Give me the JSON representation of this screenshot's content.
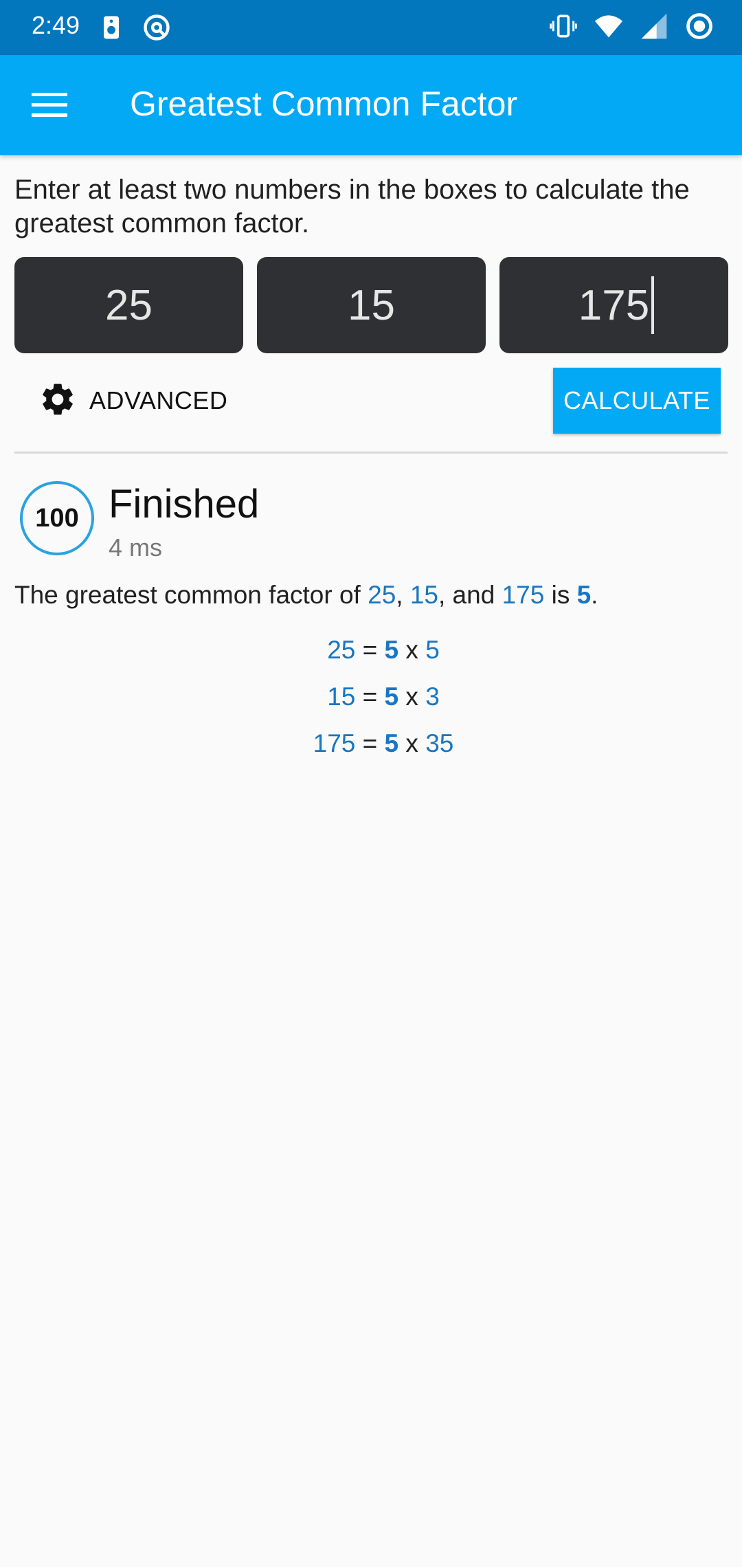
{
  "status_bar": {
    "time": "2:49",
    "left_icons": [
      "speaker-icon",
      "at-sign-icon"
    ],
    "right_icons": [
      "vibrate-icon",
      "wifi-icon",
      "signal-icon",
      "record-icon"
    ]
  },
  "app_bar": {
    "menu_icon": "hamburger-menu-icon",
    "title": "Greatest Common Factor"
  },
  "instructions": "Enter at least two numbers in the boxes to calculate the greatest common factor.",
  "inputs": [
    "25",
    "15",
    "175"
  ],
  "advanced_button": {
    "icon": "gear-icon",
    "label": "ADVANCED"
  },
  "calculate_button": {
    "label": "CALCULATE"
  },
  "result": {
    "progress": "100",
    "status": "Finished",
    "elapsed": "4 ms",
    "sentence": {
      "prefix": "The greatest common factor of ",
      "numbers": [
        "25",
        "15",
        "175"
      ],
      "sep1": ", ",
      "sep2": ", and ",
      "is_text": " is ",
      "gcf": "5",
      "end": "."
    },
    "factorizations": [
      {
        "number": "25",
        "gcf": "5",
        "cofactor": "5"
      },
      {
        "number": "15",
        "gcf": "5",
        "cofactor": "3"
      },
      {
        "number": "175",
        "gcf": "5",
        "cofactor": "35"
      }
    ],
    "equals": " = ",
    "times": " x "
  },
  "colors": {
    "status_bar": "#0277bd",
    "app_bar": "#03a9f4",
    "input_bg": "#2f3033",
    "accent_blue": "#1976c2"
  }
}
